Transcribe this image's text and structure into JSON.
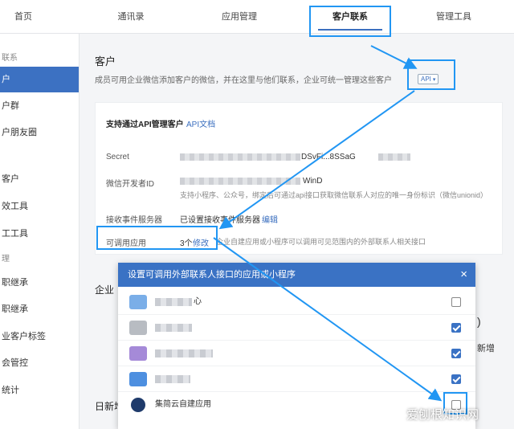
{
  "topnav": {
    "tabs": [
      {
        "label": "首页"
      },
      {
        "label": "通讯录"
      },
      {
        "label": "应用管理"
      },
      {
        "label": "客户联系"
      },
      {
        "label": "管理工具"
      }
    ]
  },
  "sidebar": {
    "items": [
      {
        "label": "联系"
      },
      {
        "label": "户"
      },
      {
        "label": "户群"
      },
      {
        "label": "户朋友圈"
      },
      {
        "label": "客户"
      },
      {
        "label": "效工具"
      },
      {
        "label": "工工具"
      },
      {
        "label": "理"
      },
      {
        "label": "职继承"
      },
      {
        "label": "职继承"
      },
      {
        "label": "业客户标签"
      },
      {
        "label": "会管控"
      },
      {
        "label": "统计"
      }
    ]
  },
  "main": {
    "title": "客户",
    "description": "成员可用企业微信添加客户的微信，并在这里与他们联系，企业可统一管理这些客户",
    "api_badge": "API",
    "panel": {
      "api_support_label": "支持通过API管理客户",
      "api_doc_link": "API文档",
      "secret_label": "Secret",
      "secret_value_fragment": "DSvFi...8SSaG",
      "wechat_dev_label": "微信开发者ID",
      "wechat_dev_fragment": "WinD",
      "wechat_dev_sub": "支持小程序、公众号，绑定后可通过api接口获取微信联系人对应的唯一身份标识（微信unionid）",
      "event_server_label": "接收事件服务器",
      "event_server_value": "已设置接收事件服务器",
      "event_server_edit": "编辑",
      "callable_apps_label": "可调用应用",
      "callable_apps_count": "3个",
      "callable_apps_edit": "修改",
      "callable_apps_desc": "企业自建应用或小程序可以调用可见范围内的外部联系人相关接口"
    },
    "section2_title": "企业",
    "section3_title": "日新增"
  },
  "modal": {
    "title": "设置可调用外部联系人接口的应用或小程序",
    "close_label": "×",
    "apps": [
      {
        "name": "心",
        "checked": false,
        "icon_color": "#7aaee8"
      },
      {
        "name": "",
        "checked": true,
        "icon_color": "#b8bcc2"
      },
      {
        "name": "",
        "checked": true,
        "icon_color": "#a58ad8"
      },
      {
        "name": "",
        "checked": true,
        "icon_color": "#4d8fe0"
      },
      {
        "name": "集简云自建应用",
        "checked": false,
        "icon_color": "#1f3b6b"
      }
    ]
  },
  "right_edge": {
    "digit": ")",
    "add_label": "新增"
  },
  "watermark": "爱刨根知识网",
  "colors": {
    "accent": "#3a72c4",
    "highlight": "#2196f3"
  }
}
